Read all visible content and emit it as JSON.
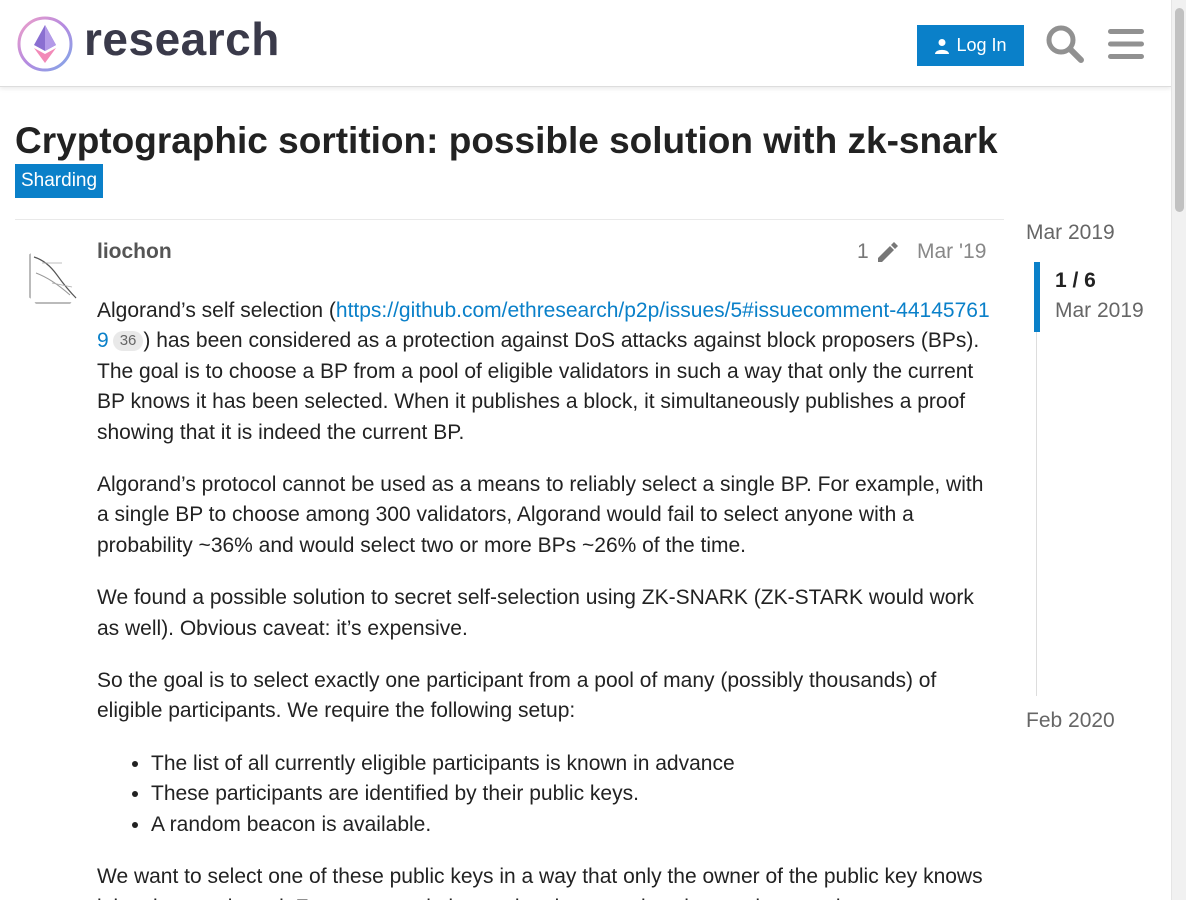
{
  "header": {
    "logo_text": "research",
    "login_label": "Log In"
  },
  "topic": {
    "title": "Cryptographic sortition: possible solution with zk-snark",
    "category": "Sharding"
  },
  "post": {
    "username": "liochon",
    "edit_count": "1",
    "date": "Mar '19",
    "p1_before": "Algorand’s self selection (",
    "p1_link": "https://github.com/ethresearch/p2p/issues/5#issuecomment-441457619",
    "p1_clicks": "36",
    "p1_after": ") has been considered as a protection against DoS attacks against block proposers (BPs). The goal is to choose a BP from a pool of eligible validators in such a way that only the current BP knows it has been selected. When it publishes a block, it simultaneously publishes a proof showing that it is indeed the current BP.",
    "p2": "Algorand’s protocol cannot be used as a means to reliably select a single BP. For example, with a single BP to choose among 300 validators, Algorand would fail to select anyone with a probability ~36% and would select two or more BPs ~26% of the time.",
    "p3": "We found a possible solution to secret self-selection using ZK-SNARK (ZK-STARK would work as well). Obvious caveat: it’s expensive.",
    "p4": "So the goal is to select exactly one participant from a pool of many (possibly thousands) of eligible participants. We require the following setup:",
    "list": [
      "The list of all currently eligible participants is known in advance",
      "These participants are identified by their public keys.",
      "A random beacon is available."
    ],
    "p5": "We want to select one of these public keys in a way that only the owner of the public key knows it has been selected. For a proposal, the random beacon gives it a random number."
  },
  "timeline": {
    "top_date": "Mar 2019",
    "count": "1 / 6",
    "count_date": "Mar 2019",
    "bottom_date": "Feb 2020"
  },
  "colors": {
    "accent": "#0a80c9",
    "text": "#222222",
    "muted": "#666666"
  },
  "icons": [
    "user-icon",
    "search-icon",
    "hamburger-menu-icon",
    "pencil-icon"
  ]
}
